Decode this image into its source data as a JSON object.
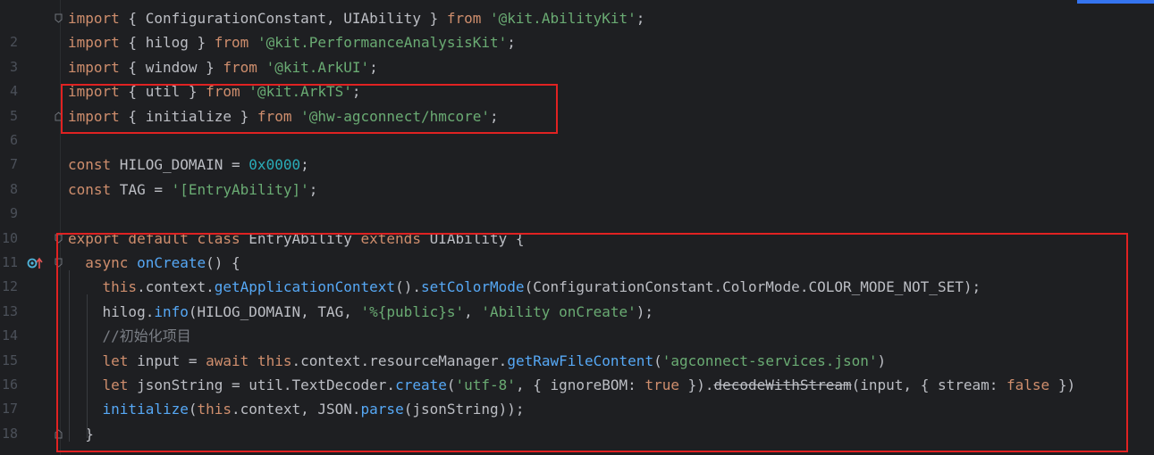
{
  "editor": {
    "accent_color": "#3574f0",
    "highlight_color": "#e02222"
  },
  "lines": [
    {
      "num": "",
      "tokens": [
        {
          "t": "import",
          "c": "kw"
        },
        {
          "t": " { ConfigurationConstant, UIAbility } ",
          "c": "plain"
        },
        {
          "t": "from",
          "c": "kw"
        },
        {
          "t": " ",
          "c": "plain"
        },
        {
          "t": "'@kit.AbilityKit'",
          "c": "str"
        },
        {
          "t": ";",
          "c": "plain"
        }
      ]
    },
    {
      "num": "2",
      "tokens": [
        {
          "t": "import",
          "c": "kw"
        },
        {
          "t": " { hilog } ",
          "c": "plain"
        },
        {
          "t": "from",
          "c": "kw"
        },
        {
          "t": " ",
          "c": "plain"
        },
        {
          "t": "'@kit.PerformanceAnalysisKit'",
          "c": "str"
        },
        {
          "t": ";",
          "c": "plain"
        }
      ]
    },
    {
      "num": "3",
      "tokens": [
        {
          "t": "import",
          "c": "kw"
        },
        {
          "t": " { window } ",
          "c": "plain"
        },
        {
          "t": "from",
          "c": "kw"
        },
        {
          "t": " ",
          "c": "plain"
        },
        {
          "t": "'@kit.ArkUI'",
          "c": "str"
        },
        {
          "t": ";",
          "c": "plain"
        }
      ]
    },
    {
      "num": "4",
      "tokens": [
        {
          "t": "import",
          "c": "kw"
        },
        {
          "t": " { util } ",
          "c": "plain"
        },
        {
          "t": "from",
          "c": "kw"
        },
        {
          "t": " ",
          "c": "plain"
        },
        {
          "t": "'@kit.ArkTS'",
          "c": "str"
        },
        {
          "t": ";",
          "c": "plain"
        }
      ]
    },
    {
      "num": "5",
      "tokens": [
        {
          "t": "import",
          "c": "kw"
        },
        {
          "t": " { initialize } ",
          "c": "plain"
        },
        {
          "t": "from",
          "c": "kw"
        },
        {
          "t": " ",
          "c": "plain"
        },
        {
          "t": "'@hw-agconnect/hmcore'",
          "c": "str"
        },
        {
          "t": ";",
          "c": "plain"
        }
      ]
    },
    {
      "num": "6",
      "tokens": []
    },
    {
      "num": "7",
      "tokens": [
        {
          "t": "const",
          "c": "kw"
        },
        {
          "t": " HILOG_DOMAIN = ",
          "c": "plain"
        },
        {
          "t": "0x0000",
          "c": "num"
        },
        {
          "t": ";",
          "c": "plain"
        }
      ]
    },
    {
      "num": "8",
      "tokens": [
        {
          "t": "const",
          "c": "kw"
        },
        {
          "t": " TAG = ",
          "c": "plain"
        },
        {
          "t": "'[EntryAbility]'",
          "c": "str"
        },
        {
          "t": ";",
          "c": "plain"
        }
      ]
    },
    {
      "num": "9",
      "tokens": []
    },
    {
      "num": "10",
      "tokens": [
        {
          "t": "export default class",
          "c": "kw"
        },
        {
          "t": " EntryAbility ",
          "c": "cls"
        },
        {
          "t": "extends",
          "c": "kw"
        },
        {
          "t": " UIAbility {",
          "c": "plain"
        }
      ]
    },
    {
      "num": "11",
      "tokens": [
        {
          "t": "  ",
          "c": "plain"
        },
        {
          "t": "async",
          "c": "kw"
        },
        {
          "t": " ",
          "c": "plain"
        },
        {
          "t": "onCreate",
          "c": "fn"
        },
        {
          "t": "() {",
          "c": "plain"
        }
      ]
    },
    {
      "num": "12",
      "tokens": [
        {
          "t": "    ",
          "c": "plain"
        },
        {
          "t": "this",
          "c": "kw"
        },
        {
          "t": ".context.",
          "c": "plain"
        },
        {
          "t": "getApplicationContext",
          "c": "fn"
        },
        {
          "t": "().",
          "c": "plain"
        },
        {
          "t": "setColorMode",
          "c": "fn"
        },
        {
          "t": "(ConfigurationConstant.ColorMode.COLOR_MODE_NOT_SET);",
          "c": "plain"
        }
      ]
    },
    {
      "num": "13",
      "tokens": [
        {
          "t": "    hilog.",
          "c": "plain"
        },
        {
          "t": "info",
          "c": "fn"
        },
        {
          "t": "(HILOG_DOMAIN, TAG, ",
          "c": "plain"
        },
        {
          "t": "'%{public}s'",
          "c": "str"
        },
        {
          "t": ", ",
          "c": "plain"
        },
        {
          "t": "'Ability onCreate'",
          "c": "str"
        },
        {
          "t": ");",
          "c": "plain"
        }
      ]
    },
    {
      "num": "14",
      "tokens": [
        {
          "t": "    ",
          "c": "plain"
        },
        {
          "t": "//初始化项目",
          "c": "comment"
        }
      ]
    },
    {
      "num": "15",
      "tokens": [
        {
          "t": "    ",
          "c": "plain"
        },
        {
          "t": "let",
          "c": "kw"
        },
        {
          "t": " input = ",
          "c": "plain"
        },
        {
          "t": "await",
          "c": "kw"
        },
        {
          "t": " ",
          "c": "plain"
        },
        {
          "t": "this",
          "c": "kw"
        },
        {
          "t": ".context.resourceManager.",
          "c": "plain"
        },
        {
          "t": "getRawFileContent",
          "c": "fn"
        },
        {
          "t": "(",
          "c": "plain"
        },
        {
          "t": "'agconnect-services.json'",
          "c": "str"
        },
        {
          "t": ")",
          "c": "plain"
        }
      ]
    },
    {
      "num": "16",
      "tokens": [
        {
          "t": "    ",
          "c": "plain"
        },
        {
          "t": "let",
          "c": "kw"
        },
        {
          "t": " jsonString = util.TextDecoder.",
          "c": "plain"
        },
        {
          "t": "create",
          "c": "fn"
        },
        {
          "t": "(",
          "c": "plain"
        },
        {
          "t": "'utf-8'",
          "c": "str"
        },
        {
          "t": ", { ignoreBOM: ",
          "c": "plain"
        },
        {
          "t": "true",
          "c": "kw"
        },
        {
          "t": " }).",
          "c": "plain"
        },
        {
          "t": "decodeWithStream",
          "c": "strike"
        },
        {
          "t": "(input, { stream: ",
          "c": "plain"
        },
        {
          "t": "false",
          "c": "kw"
        },
        {
          "t": " })",
          "c": "plain"
        }
      ]
    },
    {
      "num": "17",
      "tokens": [
        {
          "t": "    ",
          "c": "plain"
        },
        {
          "t": "initialize",
          "c": "fn"
        },
        {
          "t": "(",
          "c": "plain"
        },
        {
          "t": "this",
          "c": "kw"
        },
        {
          "t": ".context, JSON.",
          "c": "plain"
        },
        {
          "t": "parse",
          "c": "fn"
        },
        {
          "t": "(jsonString));",
          "c": "plain"
        }
      ]
    },
    {
      "num": "18",
      "tokens": [
        {
          "t": "  }",
          "c": "plain"
        }
      ]
    }
  ]
}
